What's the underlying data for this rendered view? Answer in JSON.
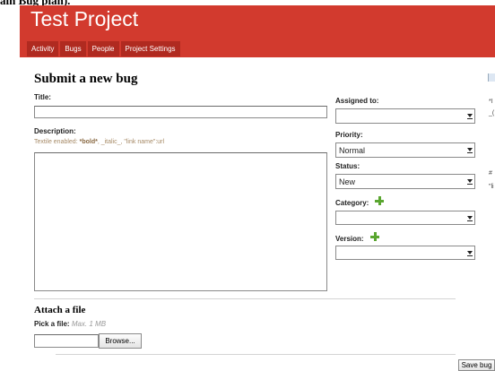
{
  "page_caption": "ain Bug plan).",
  "project": {
    "title": "Test Project"
  },
  "nav": {
    "tabs": [
      {
        "label": "Activity"
      },
      {
        "label": "Bugs"
      },
      {
        "label": "People"
      },
      {
        "label": "Project Settings"
      }
    ]
  },
  "form": {
    "heading": "Submit a new bug",
    "title_label": "Title:",
    "title_value": "",
    "description_label": "Description:",
    "description_value": "",
    "textile_hint": {
      "prefix": "Textile enabled: ",
      "bold": "*bold*",
      "rest": ", _italic_, \"link name\":url"
    },
    "assigned_to": {
      "label": "Assigned to:",
      "value": ""
    },
    "priority": {
      "label": "Priority:",
      "value": "Normal"
    },
    "status": {
      "label": "Status:",
      "value": "New"
    },
    "category": {
      "label": "Category:",
      "value": ""
    },
    "version": {
      "label": "Version:",
      "value": ""
    }
  },
  "attach": {
    "heading": "Attach a file",
    "pick_label": "Pick a file:",
    "max_size": "Max. 1 MB",
    "browse_label": "Browse..."
  },
  "save_label": "Save bug",
  "sidebar_fragments": [
    "*I",
    "_(",
    "#",
    "\"li"
  ],
  "colors": {
    "header": "#d23a2e",
    "tab": "#b02a20",
    "add_icon": "#5aa630",
    "hint": "#a68a66"
  }
}
